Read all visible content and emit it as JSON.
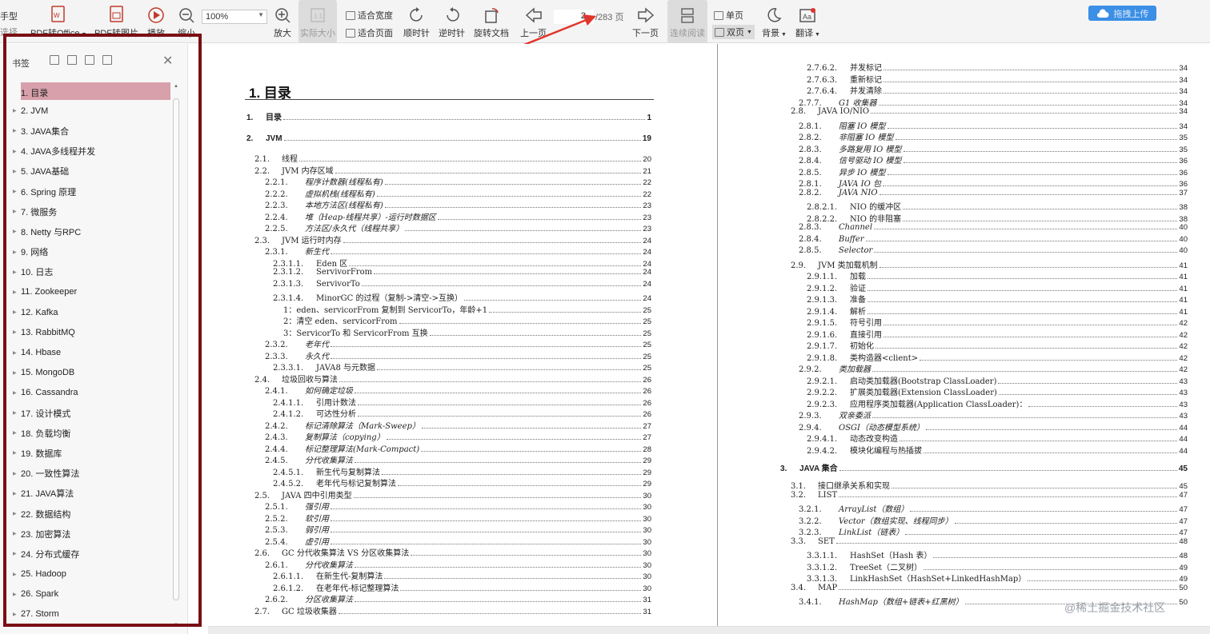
{
  "toolbar": {
    "left_partial": [
      "手型",
      "选择"
    ],
    "buttons": [
      {
        "id": "pdf-office",
        "label": "PDF转Office"
      },
      {
        "id": "pdf-image",
        "label": "PDF转图片"
      },
      {
        "id": "play",
        "label": "播放"
      },
      {
        "id": "zoom-out",
        "label": "缩小"
      },
      {
        "id": "zoom-in",
        "label": "放大"
      },
      {
        "id": "actual-size",
        "label": "实际大小"
      },
      {
        "id": "rotate-cw",
        "label": "顺时针"
      },
      {
        "id": "rotate-ccw",
        "label": "逆时针"
      },
      {
        "id": "rotate-doc",
        "label": "旋转文档"
      },
      {
        "id": "prev-page",
        "label": "上一页"
      },
      {
        "id": "next-page",
        "label": "下一页"
      },
      {
        "id": "continuous",
        "label": "连续阅读"
      },
      {
        "id": "background",
        "label": "背景"
      },
      {
        "id": "translate",
        "label": "翻译"
      }
    ],
    "fit_width": "适合宽度",
    "fit_page": "适合页面",
    "single_page": "单页",
    "double_page": "双页",
    "zoom_value": "100%",
    "page_current": "2",
    "page_total": "/283 页",
    "upload_label": "拖拽上传"
  },
  "sidebar": {
    "title": "书签",
    "items": [
      {
        "label": "1. 目录",
        "selected": true
      },
      {
        "label": "2. JVM"
      },
      {
        "label": "3. JAVA集合"
      },
      {
        "label": "4. JAVA多线程并发"
      },
      {
        "label": "5. JAVA基础"
      },
      {
        "label": "6. Spring 原理"
      },
      {
        "label": "7.   微服务"
      },
      {
        "label": "8. Netty 与RPC"
      },
      {
        "label": "9. 网络"
      },
      {
        "label": "10. 日志"
      },
      {
        "label": "11. Zookeeper"
      },
      {
        "label": "12. Kafka"
      },
      {
        "label": "13. RabbitMQ"
      },
      {
        "label": "14. Hbase"
      },
      {
        "label": "15. MongoDB"
      },
      {
        "label": "16. Cassandra"
      },
      {
        "label": "17. 设计模式"
      },
      {
        "label": "18. 负载均衡"
      },
      {
        "label": "19. 数据库"
      },
      {
        "label": "20. 一致性算法"
      },
      {
        "label": "21. JAVA算法"
      },
      {
        "label": "22. 数据结构"
      },
      {
        "label": "23. 加密算法"
      },
      {
        "label": "24. 分布式缓存"
      },
      {
        "label": "25. Hadoop"
      },
      {
        "label": "26. Spark"
      },
      {
        "label": "27. Storm"
      }
    ]
  },
  "document": {
    "heading": "1. 目录",
    "left_toc": [
      {
        "num": "1.",
        "title": "目录",
        "page": "1",
        "s": "b"
      },
      {
        "num": "2.",
        "title": "JVM",
        "page": "19",
        "s": "b"
      },
      {
        "num": "2.1.",
        "title": "线程",
        "page": "20",
        "s": "r"
      },
      {
        "num": "2.2.",
        "title": "JVM 内存区域",
        "page": "21",
        "s": "r"
      },
      {
        "num": "2.2.1.",
        "title": "程序计数器(线程私有)",
        "page": "22",
        "s": "i"
      },
      {
        "num": "2.2.2.",
        "title": "虚拟机栈(线程私有)",
        "page": "22",
        "s": "i"
      },
      {
        "num": "2.2.3.",
        "title": "本地方法区(线程私有)",
        "page": "23",
        "s": "i"
      },
      {
        "num": "2.2.4.",
        "title": "堆（Heap-线程共享）-运行时数据区",
        "page": "23",
        "s": "i"
      },
      {
        "num": "2.2.5.",
        "title": "方法区/永久代（线程共享）",
        "page": "23",
        "s": "i"
      },
      {
        "num": "2.3.",
        "title": "JVM 运行时内存",
        "page": "24",
        "s": "r"
      },
      {
        "num": "2.3.1.",
        "title": "新生代",
        "page": "24",
        "s": "i"
      },
      {
        "num": "2.3.1.1.",
        "title": "Eden 区",
        "page": "24",
        "s": "r"
      },
      {
        "num": "2.3.1.2.",
        "title": "ServivorFrom",
        "page": "24",
        "s": "r"
      },
      {
        "num": "2.3.1.3.",
        "title": "ServivorTo",
        "page": "24",
        "s": "r"
      },
      {
        "num": "2.3.1.4.",
        "title": "MinorGC 的过程（复制->清空->互换）",
        "page": "24",
        "s": "r"
      },
      {
        "num": "1：",
        "title": "eden、servicorFrom 复制到 ServicorTo，年龄+1",
        "page": "25",
        "s": "r"
      },
      {
        "num": "2：",
        "title": "清空 eden、servicorFrom",
        "page": "25",
        "s": "r"
      },
      {
        "num": "3：",
        "title": "ServicorTo 和 ServicorFrom 互换",
        "page": "25",
        "s": "r"
      },
      {
        "num": "2.3.2.",
        "title": "老年代",
        "page": "25",
        "s": "i"
      },
      {
        "num": "2.3.3.",
        "title": "永久代",
        "page": "25",
        "s": "i"
      },
      {
        "num": "2.3.3.1.",
        "title": "JAVA8 与元数据",
        "page": "25",
        "s": "r"
      },
      {
        "num": "2.4.",
        "title": "垃圾回收与算法",
        "page": "26",
        "s": "r"
      },
      {
        "num": "2.4.1.",
        "title": "如何确定垃圾",
        "page": "26",
        "s": "i"
      },
      {
        "num": "2.4.1.1.",
        "title": "引用计数法",
        "page": "26",
        "s": "r"
      },
      {
        "num": "2.4.1.2.",
        "title": "可达性分析",
        "page": "26",
        "s": "r"
      },
      {
        "num": "2.4.2.",
        "title": "标记清除算法（Mark-Sweep）",
        "page": "27",
        "s": "i"
      },
      {
        "num": "2.4.3.",
        "title": "复制算法（copying）",
        "page": "27",
        "s": "i"
      },
      {
        "num": "2.4.4.",
        "title": "标记整理算法(Mark-Compact)",
        "page": "28",
        "s": "i"
      },
      {
        "num": "2.4.5.",
        "title": "分代收集算法",
        "page": "29",
        "s": "i"
      },
      {
        "num": "2.4.5.1.",
        "title": "新生代与复制算法",
        "page": "29",
        "s": "r"
      },
      {
        "num": "2.4.5.2.",
        "title": "老年代与标记复制算法",
        "page": "29",
        "s": "r"
      },
      {
        "num": "2.5.",
        "title": "JAVA 四中引用类型",
        "page": "30",
        "s": "r"
      },
      {
        "num": "2.5.1.",
        "title": "强引用",
        "page": "30",
        "s": "i"
      },
      {
        "num": "2.5.2.",
        "title": "软引用",
        "page": "30",
        "s": "i"
      },
      {
        "num": "2.5.3.",
        "title": "弱引用",
        "page": "30",
        "s": "i"
      },
      {
        "num": "2.5.4.",
        "title": "虚引用",
        "page": "30",
        "s": "i"
      },
      {
        "num": "2.6.",
        "title": "GC 分代收集算法  VS 分区收集算法",
        "page": "30",
        "s": "r"
      },
      {
        "num": "2.6.1.",
        "title": "分代收集算法",
        "page": "30",
        "s": "i"
      },
      {
        "num": "2.6.1.1.",
        "title": "在新生代-复制算法",
        "page": "30",
        "s": "r"
      },
      {
        "num": "2.6.1.2.",
        "title": "在老年代-标记整理算法",
        "page": "30",
        "s": "r"
      },
      {
        "num": "2.6.2.",
        "title": "分区收集算法",
        "page": "31",
        "s": "i"
      },
      {
        "num": "2.7.",
        "title": "GC 垃圾收集器",
        "page": "31",
        "s": "r"
      }
    ],
    "right_toc": [
      {
        "num": "2.7.6.2.",
        "title": "并发标记",
        "page": "34",
        "s": "r"
      },
      {
        "num": "2.7.6.3.",
        "title": "重新标记",
        "page": "34",
        "s": "r"
      },
      {
        "num": "2.7.6.4.",
        "title": "并发清除",
        "page": "34",
        "s": "r"
      },
      {
        "num": "2.7.7.",
        "title": "G1 收集器",
        "page": "34",
        "s": "i"
      },
      {
        "num": "2.8.",
        "title": "JAVA IO/NIO",
        "page": "34",
        "s": "r"
      },
      {
        "num": "2.8.1.",
        "title": "阻塞 IO 模型",
        "page": "34",
        "s": "i"
      },
      {
        "num": "2.8.2.",
        "title": "非阻塞 IO 模型",
        "page": "35",
        "s": "i"
      },
      {
        "num": "2.8.3.",
        "title": "多路复用 IO 模型",
        "page": "35",
        "s": "i"
      },
      {
        "num": "2.8.4.",
        "title": "信号驱动 IO 模型",
        "page": "36",
        "s": "i"
      },
      {
        "num": "2.8.5.",
        "title": "异步 IO 模型",
        "page": "36",
        "s": "i"
      },
      {
        "num": "2.8.1.",
        "title": "JAVA IO 包",
        "page": "36",
        "s": "i"
      },
      {
        "num": "2.8.2.",
        "title": "JAVA NIO",
        "page": "37",
        "s": "i"
      },
      {
        "num": "2.8.2.1.",
        "title": "NIO 的缓冲区",
        "page": "38",
        "s": "r"
      },
      {
        "num": "2.8.2.2.",
        "title": "NIO 的非阻塞",
        "page": "38",
        "s": "r"
      },
      {
        "num": "2.8.3.",
        "title": "Channel",
        "page": "40",
        "s": "i"
      },
      {
        "num": "2.8.4.",
        "title": "Buffer",
        "page": "40",
        "s": "i"
      },
      {
        "num": "2.8.5.",
        "title": "Selector",
        "page": "40",
        "s": "i"
      },
      {
        "num": "2.9.",
        "title": "JVM 类加载机制",
        "page": "41",
        "s": "r"
      },
      {
        "num": "2.9.1.1.",
        "title": "加载",
        "page": "41",
        "s": "r"
      },
      {
        "num": "2.9.1.2.",
        "title": "验证",
        "page": "41",
        "s": "r"
      },
      {
        "num": "2.9.1.3.",
        "title": "准备",
        "page": "41",
        "s": "r"
      },
      {
        "num": "2.9.1.4.",
        "title": "解析",
        "page": "41",
        "s": "r"
      },
      {
        "num": "2.9.1.5.",
        "title": "符号引用",
        "page": "42",
        "s": "r"
      },
      {
        "num": "2.9.1.6.",
        "title": "直接引用",
        "page": "42",
        "s": "r"
      },
      {
        "num": "2.9.1.7.",
        "title": "初始化",
        "page": "42",
        "s": "r"
      },
      {
        "num": "2.9.1.8.",
        "title": "类构造器<client>",
        "page": "42",
        "s": "r"
      },
      {
        "num": "2.9.2.",
        "title": "类加载器",
        "page": "42",
        "s": "i"
      },
      {
        "num": "2.9.2.1.",
        "title": "启动类加载器(Bootstrap ClassLoader)",
        "page": "43",
        "s": "r"
      },
      {
        "num": "2.9.2.2.",
        "title": "扩展类加载器(Extension ClassLoader)",
        "page": "43",
        "s": "r"
      },
      {
        "num": "2.9.2.3.",
        "title": "应用程序类加载器(Application ClassLoader)：",
        "page": "43",
        "s": "r"
      },
      {
        "num": "2.9.3.",
        "title": "双亲委派",
        "page": "43",
        "s": "i"
      },
      {
        "num": "2.9.4.",
        "title": "OSGI（动态模型系统）",
        "page": "44",
        "s": "i"
      },
      {
        "num": "2.9.4.1.",
        "title": "动态改变构造",
        "page": "44",
        "s": "r"
      },
      {
        "num": "2.9.4.2.",
        "title": "模块化编程与热插拔",
        "page": "44",
        "s": "r"
      },
      {
        "num": "3.",
        "title": "JAVA 集合",
        "page": "45",
        "s": "b"
      },
      {
        "num": "3.1.",
        "title": "接口继承关系和实现",
        "page": "45",
        "s": "r"
      },
      {
        "num": "3.2.",
        "title": "LIST",
        "page": "47",
        "s": "r"
      },
      {
        "num": "3.2.1.",
        "title": "ArrayList（数组）",
        "page": "47",
        "s": "i"
      },
      {
        "num": "3.2.2.",
        "title": "Vector（数组实现、线程同步）",
        "page": "47",
        "s": "i"
      },
      {
        "num": "3.2.3.",
        "title": "LinkList（链表）",
        "page": "47",
        "s": "i"
      },
      {
        "num": "3.3.",
        "title": "SET",
        "page": "48",
        "s": "r"
      },
      {
        "num": "3.3.1.1.",
        "title": "HashSet（Hash 表）",
        "page": "48",
        "s": "r"
      },
      {
        "num": "3.3.1.2.",
        "title": "TreeSet（二叉树）",
        "page": "49",
        "s": "r"
      },
      {
        "num": "3.3.1.3.",
        "title": "LinkHashSet（HashSet+LinkedHashMap）",
        "page": "49",
        "s": "r"
      },
      {
        "num": "3.4.",
        "title": "MAP",
        "page": "50",
        "s": "r"
      },
      {
        "num": "3.4.1.",
        "title": "HashMap（数组+链表+红黑树）",
        "page": "50",
        "s": "i"
      }
    ]
  },
  "watermark": "@稀土掘金技术社区",
  "colors": {
    "bookmark_frame": "#7a0f14",
    "selected_bookmark": "#d7a0aa",
    "upload_button": "#3b8fe5",
    "arrow": "#e0362c"
  }
}
